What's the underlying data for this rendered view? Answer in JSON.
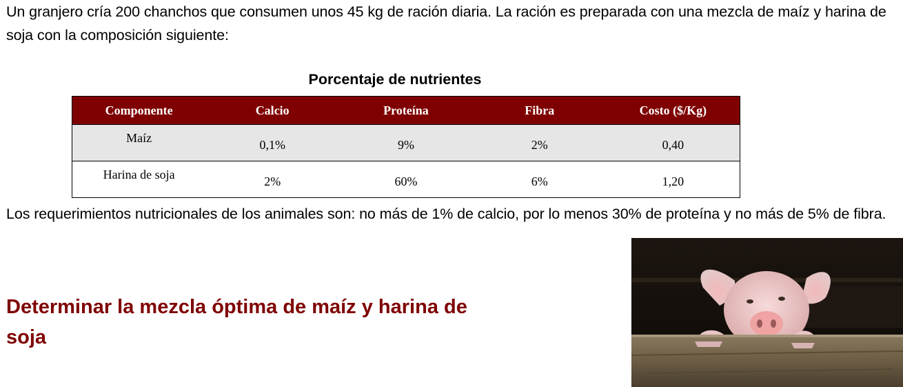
{
  "intro_text": "Un granjero cría 200 chanchos que consumen unos 45 kg de ración diaria. La ración es preparada con una mezcla de maíz y harina de soja con la composición siguiente:",
  "table": {
    "caption": "Porcentaje de nutrientes",
    "headers": [
      "Componente",
      "Calcio",
      "Proteína",
      "Fibra",
      "Costo ($/Kg)"
    ],
    "rows": [
      [
        "Maíz",
        "0,1%",
        "9%",
        "2%",
        "0,40"
      ],
      [
        "Harina de soja",
        "2%",
        "60%",
        "6%",
        "1,20"
      ]
    ]
  },
  "requirements_text": "Los requerimientos nutricionales de los animales son: no más de 1% de calcio, por lo menos 30% de proteína y no más de 5% de fibra.",
  "task_title": "Determinar la mezcla óptima de maíz y harina de soja",
  "colors": {
    "header_bg": "#7f0000",
    "title_text": "#7f0000",
    "row_shade": "#e6e6e6"
  }
}
